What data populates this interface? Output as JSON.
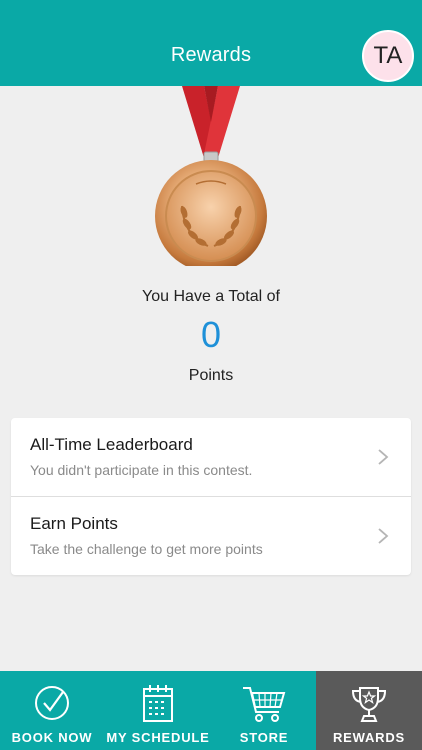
{
  "header": {
    "title": "Rewards",
    "avatar_initials": "TA"
  },
  "summary": {
    "total_label": "You Have a Total of",
    "points_value": "0",
    "points_label": "Points"
  },
  "menu": [
    {
      "title": "All-Time Leaderboard",
      "subtitle": "You didn't participate in this contest."
    },
    {
      "title": "Earn Points",
      "subtitle": "Take the challenge to get more points"
    }
  ],
  "tabs": [
    {
      "label": "BOOK NOW",
      "icon": "check-circle-icon",
      "active": false
    },
    {
      "label": "MY SCHEDULE",
      "icon": "calendar-icon",
      "active": false
    },
    {
      "label": "STORE",
      "icon": "cart-icon",
      "active": false
    },
    {
      "label": "REWARDS",
      "icon": "trophy-icon",
      "active": true
    }
  ],
  "colors": {
    "brand": "#0aa9a6",
    "active_tab": "#5a5a5a",
    "points": "#1e90d8",
    "avatar_bg": "#fde1ea"
  }
}
